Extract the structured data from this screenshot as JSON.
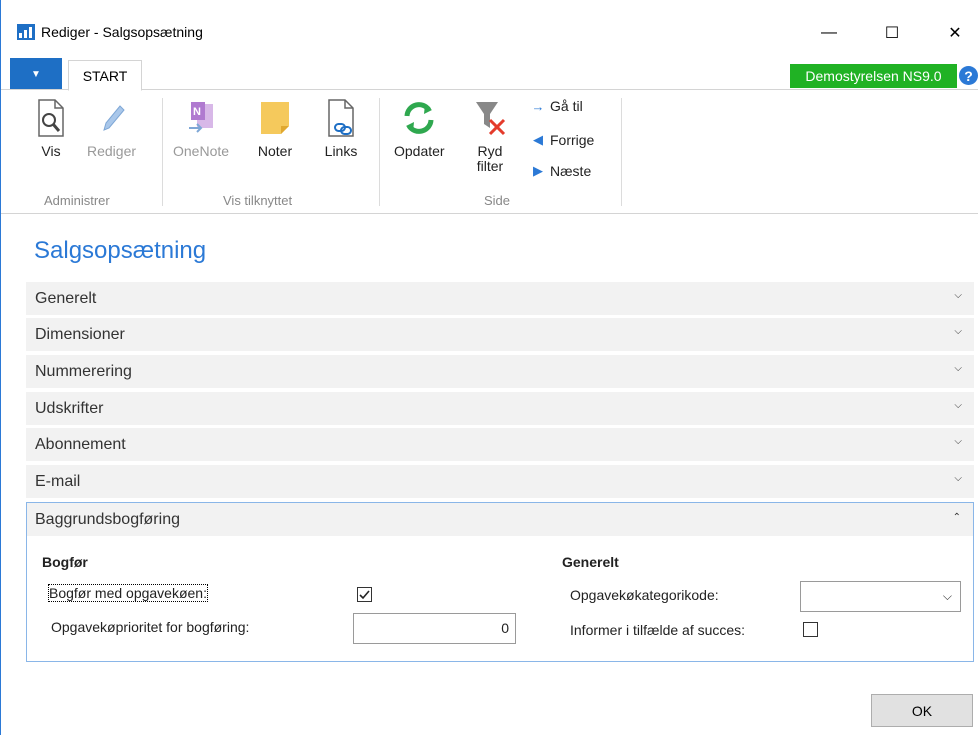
{
  "window": {
    "title": "Rediger - Salgsopsætning",
    "minimize_glyph": "—",
    "maximize_glyph": "☐",
    "close_glyph": "✕"
  },
  "ribbon": {
    "menu_glyph": "▼",
    "tab_label": "START",
    "company": "Demostyrelsen NS9.0",
    "help_glyph": "?",
    "groups": {
      "administrer": {
        "label": "Administrer",
        "vis": "Vis",
        "rediger": "Rediger"
      },
      "vis_tilknyttet": {
        "label": "Vis tilknyttet",
        "onenote": "OneNote",
        "noter": "Noter",
        "links": "Links"
      },
      "side": {
        "label": "Side",
        "opdater": "Opdater",
        "ryd_filter_line1": "Ryd",
        "ryd_filter_line2": "filter",
        "gaa_til": "Gå til",
        "forrige": "Forrige",
        "naeste": "Næste"
      }
    }
  },
  "page": {
    "title": "Salgsopsætning",
    "sections": [
      "Generelt",
      "Dimensioner",
      "Nummerering",
      "Udskrifter",
      "Abonnement",
      "E-mail"
    ],
    "collapsed_chevron": "⌄",
    "expanded": {
      "title": "Baggrundsbogføring",
      "chevron": "⌃",
      "left_heading": "Bogfør",
      "right_heading": "Generelt",
      "bogfor_med_opgavekoen_label": "Bogfør med opgavekøen:",
      "bogfor_med_opgavekoen_checked": true,
      "prioritet_label": "Opgavekøprioritet for bogføring:",
      "prioritet_value": "0",
      "kategorikode_label": "Opgavekøkategorikode:",
      "kategorikode_value": "",
      "informer_label": "Informer i tilfælde af succes:",
      "informer_checked": false
    }
  },
  "footer": {
    "ok_label": "OK"
  }
}
